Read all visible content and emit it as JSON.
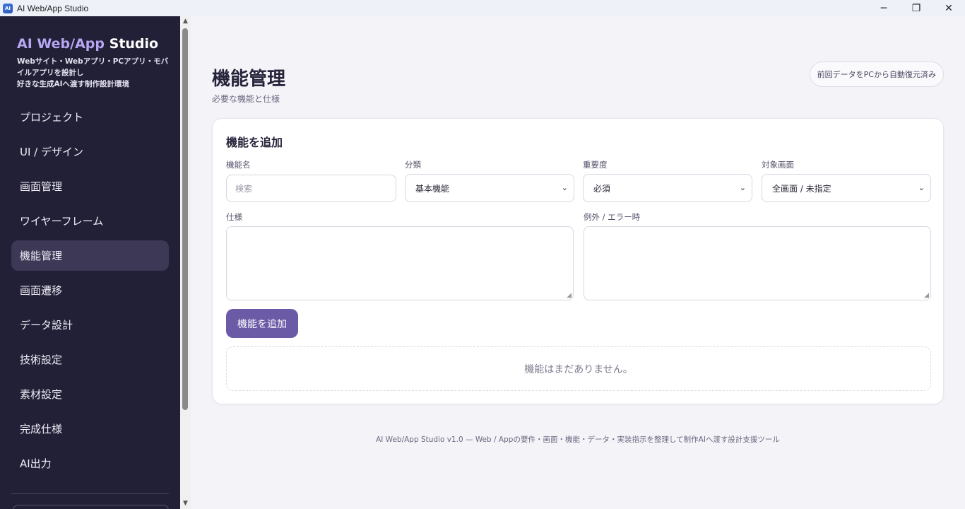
{
  "window": {
    "title": "AI Web/App Studio",
    "controls": {
      "minimize": "─",
      "maximize": "❐",
      "close": "✕"
    }
  },
  "sidebar": {
    "brand_accent": "AI Web/App",
    "brand_rest": " Studio",
    "tagline_line1": "Webサイト・Webアプリ・PCアプリ・モバイルアプリを設計し",
    "tagline_line2": "好きな生成AIへ渡す制作設計環境",
    "items": [
      {
        "label": "プロジェクト"
      },
      {
        "label": "UI / デザイン"
      },
      {
        "label": "画面管理"
      },
      {
        "label": "ワイヤーフレーム"
      },
      {
        "label": "機能管理",
        "active": true
      },
      {
        "label": "画面遷移"
      },
      {
        "label": "データ設計"
      },
      {
        "label": "技術設定"
      },
      {
        "label": "素材設定"
      },
      {
        "label": "完成仕様"
      },
      {
        "label": "AI出力"
      }
    ]
  },
  "header": {
    "title": "機能管理",
    "subtitle": "必要な機能と仕様",
    "autosave_status": "前回データをPCから自動復元済み"
  },
  "form": {
    "card_title": "機能を追加",
    "name_label": "機能名",
    "name_placeholder": "検索",
    "category_label": "分類",
    "category_value": "基本機能",
    "priority_label": "重要度",
    "priority_value": "必須",
    "target_label": "対象画面",
    "target_value": "全画面 / 未指定",
    "spec_label": "仕様",
    "exception_label": "例外 / エラー時",
    "add_button": "機能を追加",
    "empty_message": "機能はまだありません。"
  },
  "footer": {
    "text": "AI Web/App Studio v1.0 — Web / Appの要件・画面・機能・データ・実装指示を整理して制作AIへ渡す設計支援ツール"
  },
  "colors": {
    "sidebar_bg": "#222036",
    "sidebar_active": "#3c3856",
    "brand_accent": "#b7a6f2",
    "primary_button": "#6b5aa6",
    "page_bg": "#f4f3f8"
  }
}
